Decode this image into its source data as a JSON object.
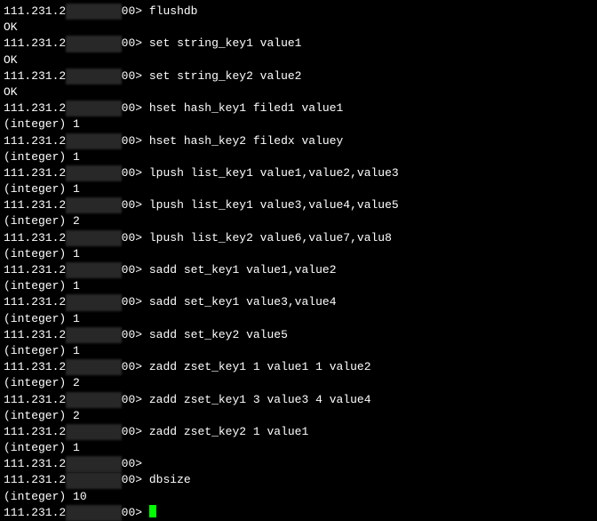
{
  "ip_prefix": "111.231.2",
  "prompt_suffix": "00>",
  "lines": [
    {
      "type": "cmd",
      "text": "flushdb"
    },
    {
      "type": "out",
      "text": "OK"
    },
    {
      "type": "cmd",
      "text": "set string_key1 value1"
    },
    {
      "type": "out",
      "text": "OK"
    },
    {
      "type": "cmd",
      "text": "set string_key2 value2"
    },
    {
      "type": "out",
      "text": "OK"
    },
    {
      "type": "cmd",
      "text": "hset hash_key1 filed1 value1"
    },
    {
      "type": "out",
      "text": "(integer) 1"
    },
    {
      "type": "cmd",
      "text": "hset hash_key2 filedx valuey"
    },
    {
      "type": "out",
      "text": "(integer) 1"
    },
    {
      "type": "cmd",
      "text": "lpush list_key1 value1,value2,value3"
    },
    {
      "type": "out",
      "text": "(integer) 1"
    },
    {
      "type": "cmd",
      "text": "lpush list_key1 value3,value4,value5"
    },
    {
      "type": "out",
      "text": "(integer) 2"
    },
    {
      "type": "cmd",
      "text": "lpush list_key2 value6,value7,valu8"
    },
    {
      "type": "out",
      "text": "(integer) 1"
    },
    {
      "type": "cmd",
      "text": "sadd set_key1 value1,value2"
    },
    {
      "type": "out",
      "text": "(integer) 1"
    },
    {
      "type": "cmd",
      "text": "sadd set_key1 value3,value4"
    },
    {
      "type": "out",
      "text": "(integer) 1"
    },
    {
      "type": "cmd",
      "text": "sadd set_key2 value5"
    },
    {
      "type": "out",
      "text": "(integer) 1"
    },
    {
      "type": "cmd",
      "text": "zadd zset_key1 1 value1 1 value2"
    },
    {
      "type": "out",
      "text": "(integer) 2"
    },
    {
      "type": "cmd",
      "text": "zadd zset_key1 3 value3 4 value4"
    },
    {
      "type": "out",
      "text": "(integer) 2"
    },
    {
      "type": "cmd",
      "text": "zadd zset_key2 1 value1"
    },
    {
      "type": "out",
      "text": "(integer) 1"
    },
    {
      "type": "cmd",
      "text": ""
    },
    {
      "type": "cmd",
      "text": "dbsize"
    },
    {
      "type": "out",
      "text": "(integer) 10"
    },
    {
      "type": "cursor",
      "text": ""
    }
  ]
}
